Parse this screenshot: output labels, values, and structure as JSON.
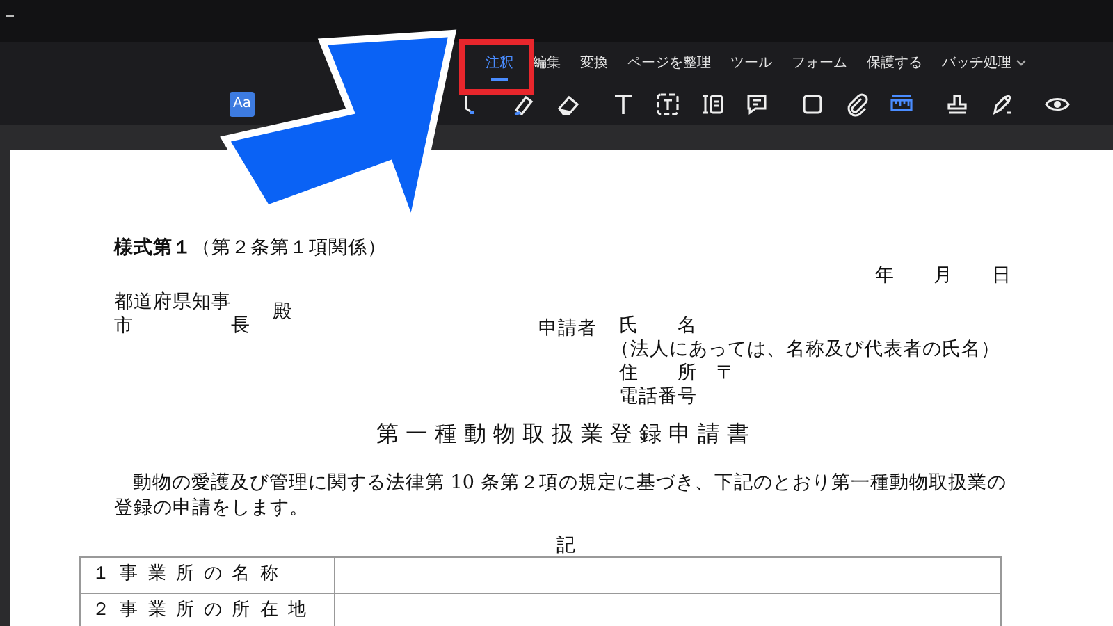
{
  "tabs": [
    {
      "label": "注釈",
      "selected": true,
      "dropdown": false
    },
    {
      "label": "編集",
      "selected": false,
      "dropdown": false
    },
    {
      "label": "変換",
      "selected": false,
      "dropdown": false
    },
    {
      "label": "ページを整理",
      "selected": false,
      "dropdown": false
    },
    {
      "label": "ツール",
      "selected": false,
      "dropdown": false
    },
    {
      "label": "フォーム",
      "selected": false,
      "dropdown": false
    },
    {
      "label": "保護する",
      "selected": false,
      "dropdown": false
    },
    {
      "label": "バッチ処理",
      "selected": false,
      "dropdown": true
    }
  ],
  "tools": [
    {
      "kind": "textstyle",
      "label": "Aa",
      "selected": true
    },
    {
      "kind": "underline",
      "selected": false
    },
    {
      "kind": "highlighter",
      "selected": false
    },
    {
      "kind": "eraser",
      "selected": false
    },
    {
      "kind": "text",
      "selected": false
    },
    {
      "kind": "textbox",
      "selected": false
    },
    {
      "kind": "callout",
      "selected": false
    },
    {
      "kind": "note",
      "selected": false
    },
    {
      "kind": "rectangle",
      "selected": false
    },
    {
      "kind": "attachment",
      "selected": false
    },
    {
      "kind": "measure",
      "selected": true
    },
    {
      "kind": "stamp",
      "selected": false
    },
    {
      "kind": "sign",
      "selected": false
    },
    {
      "kind": "view",
      "selected": false
    }
  ],
  "document": {
    "form_label": "**様式第１**（第２条第１項関係）",
    "date": "年　　月　　日",
    "addressee": [
      "都道府県知事",
      "市　　　　　長"
    ],
    "honorific": "殿",
    "applicant_label": "申請者",
    "applicant_lines": [
      "氏　　名",
      "（法人にあっては、名称及び代表者の氏名）",
      "住　　所　〒",
      "電話番号"
    ],
    "title": "第一種動物取扱業登録申請書",
    "body": "動物の愛護及び管理に関する法律第 10 条第２項の規定に基づき、下記のとおり第一種動物取扱業の登録の申請をします。",
    "note_heading": "記",
    "table_rows": [
      {
        "label": "１ 事 業 所 の 名 称"
      },
      {
        "label": "２ 事 業 所 の 所 在 地"
      }
    ]
  }
}
